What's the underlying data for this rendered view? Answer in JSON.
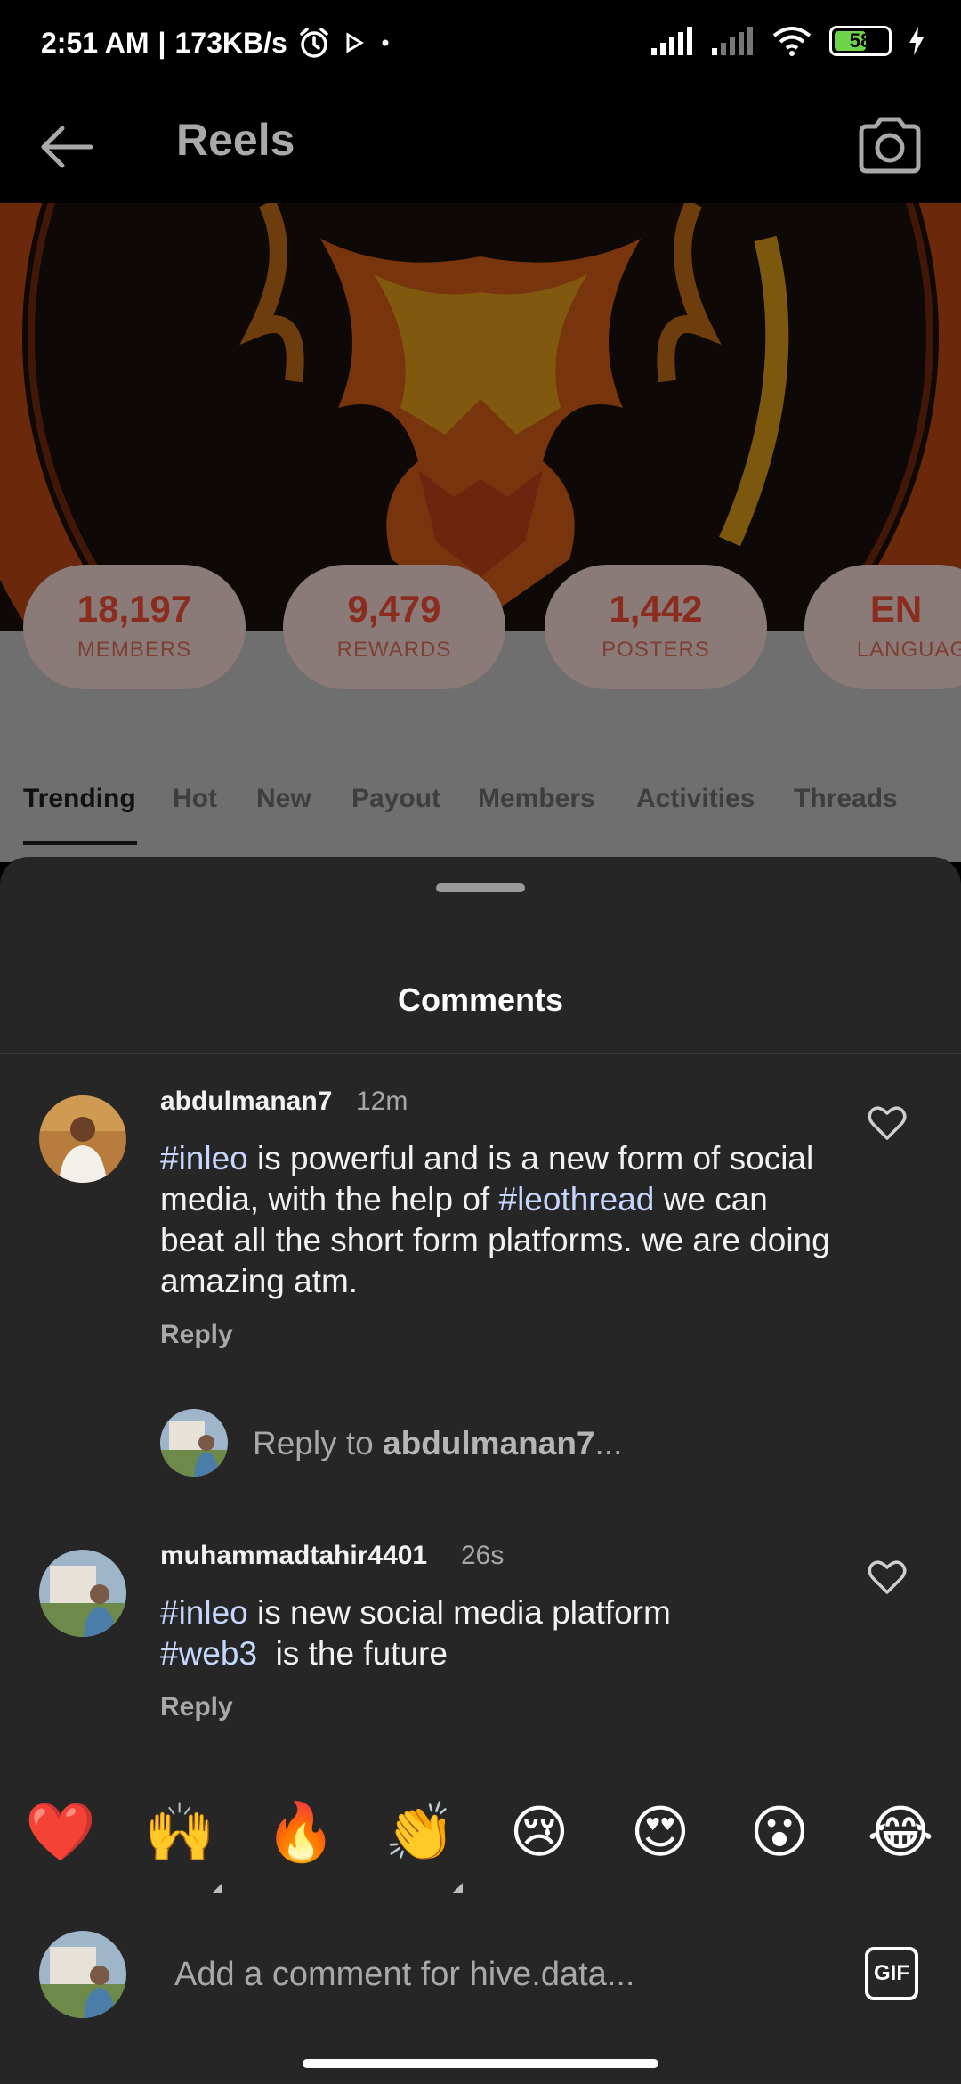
{
  "status_bar": {
    "time": "2:51 AM",
    "speed": "173KB/s",
    "separator": "|",
    "battery_level": "58",
    "icons": [
      "alarm-icon",
      "media-play-icon",
      "dot-icon",
      "signal-icon",
      "signal-icon",
      "wifi-icon",
      "battery-icon",
      "charging-icon"
    ]
  },
  "app_bar": {
    "title": "Reels",
    "back_icon": "back-arrow-icon",
    "camera_icon": "camera-icon"
  },
  "community": {
    "stats": [
      {
        "value": "18,197",
        "label": "MEMBERS"
      },
      {
        "value": "9,479",
        "label": "REWARDS"
      },
      {
        "value": "1,442",
        "label": "POSTERS"
      },
      {
        "value": "EN",
        "label": "LANGUAG"
      }
    ],
    "tabs": [
      "Trending",
      "Hot",
      "New",
      "Payout",
      "Members",
      "Activities",
      "Threads"
    ],
    "active_tab": "Trending"
  },
  "sheet": {
    "title": "Comments"
  },
  "comments": [
    {
      "username": "abdulmanan7",
      "time": "12m",
      "text_parts": [
        {
          "text": "#inleo",
          "tag": true
        },
        {
          "text": " is powerful and is a new form of social media, with the help of ",
          "tag": false
        },
        {
          "text": "#leothread",
          "tag": true
        },
        {
          "text": " we can beat all the short form platforms. we are doing amazing atm.",
          "tag": false
        }
      ],
      "reply_label": "Reply"
    },
    {
      "username": "muhammadtahir4401",
      "time": "26s",
      "text_parts": [
        {
          "text": "#inleo",
          "tag": true
        },
        {
          "text": " is new social media platform ",
          "tag": false
        },
        {
          "text": "#web3",
          "tag": true
        },
        {
          "text": "  is the future",
          "tag": false
        }
      ],
      "reply_label": "Reply"
    }
  ],
  "reply_prompt": {
    "prefix": "Reply to ",
    "username": "abdulmanan7",
    "suffix": "..."
  },
  "emojis": [
    "❤️",
    "🙌",
    "🔥",
    "👏",
    "😢",
    "😍",
    "😮",
    "😂"
  ],
  "composer": {
    "placeholder": "Add a comment for hive.data...",
    "gif_label": "GIF"
  },
  "colors": {
    "sheet_bg": "#262626",
    "hashtag": "#c5d6ff",
    "muted_text": "#a8a8a8",
    "accent_orange": "#e0631f"
  }
}
